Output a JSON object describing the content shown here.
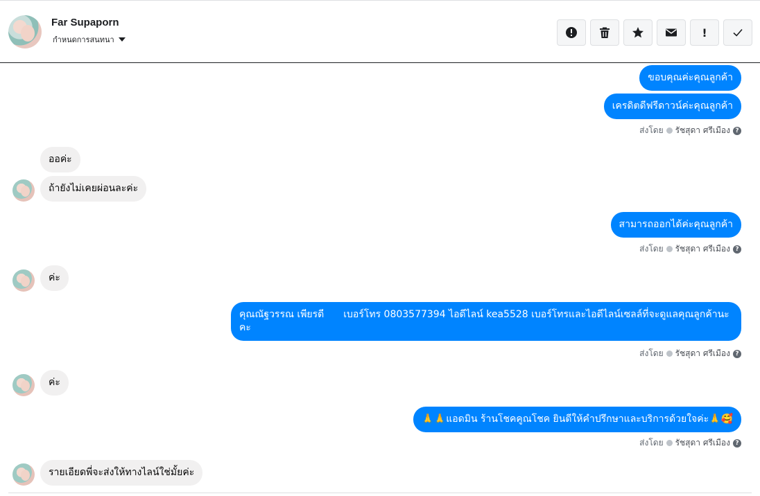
{
  "header": {
    "name": "Far Supaporn",
    "subtitle": "กำหนดการสนทนา",
    "toolbar": [
      {
        "icon": "alert-circle-icon"
      },
      {
        "icon": "trash-icon"
      },
      {
        "icon": "star-icon"
      },
      {
        "icon": "envelope-icon"
      },
      {
        "icon": "exclamation-icon",
        "label": "!"
      },
      {
        "icon": "check-icon"
      }
    ]
  },
  "messages": {
    "m1": "ขอบคุณค่ะคุณลูกค้า",
    "m2": "เครดิตดีฟรีดาวน์ค่ะคุณลูกค้า",
    "m3": "ออค่ะ",
    "m4": "ถ้ายังไม่เคยผ่อนละค่ะ",
    "m5": "สามารถออกได้ค่ะคุณลูกค้า",
    "m6": "ค่ะ",
    "m7a": "คุณณัฐวรรณ เพียรดี",
    "m7b": "เบอร์โทร 0803577394  ไอดีไลน์ kea5528   เบอร์โทรและไอดีไลน์เซลล์ที่จะดูแลคุณลูกค้านะคะ",
    "m8": "ค่ะ",
    "m9": "🙏🙏แอดมิน ร้านโชคคูณโชค ยินดีให้คำปรึกษาและบริการด้วยใจค่ะ🙏🥰",
    "m10": "รายเอียดพี่จะส่งให้ทางไลน์ใช่มั้ยค่ะ"
  },
  "sent_by": {
    "prefix": "ส่งโดย",
    "agent": "รัชสุดา ศรีเมือง",
    "help": "?"
  },
  "colors": {
    "outgoing_bubble": "#0084ff",
    "incoming_bubble": "#f1f0f0"
  }
}
